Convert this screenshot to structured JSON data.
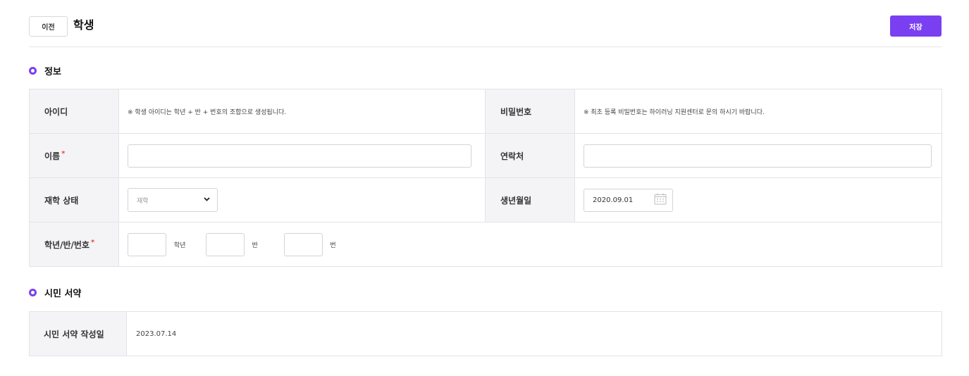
{
  "header": {
    "back_label": "이전",
    "title": "학생",
    "save_label": "저장"
  },
  "sections": {
    "info_title": "정보",
    "charter_title": "시민 서약"
  },
  "info": {
    "id_label": "아이디",
    "id_note": "※ 학생 아이디는 학년 + 반 + 번호의 조합으로 생성됩니다.",
    "password_label": "비밀번호",
    "password_note": "※ 최초 등록 비밀번호는 하이러닝 지원센터로 문의 하시기 바랍니다.",
    "name_label": "이름",
    "name_value": "",
    "contact_label": "연락처",
    "contact_value": "",
    "status_label": "재학 상태",
    "status_value": "재학",
    "birth_label": "생년월일",
    "birth_value": "2020.09.01",
    "class_label": "학년/반/번호",
    "grade_unit": "학년",
    "class_unit": "반",
    "number_unit": "번",
    "required_mark": "*"
  },
  "charter": {
    "date_label": "시민 서약 작성일",
    "date_value": "2023.07.14"
  },
  "colors": {
    "accent": "#7b3ff2",
    "required": "#e84a4a",
    "header_cell_bg": "#f4f4f7"
  }
}
